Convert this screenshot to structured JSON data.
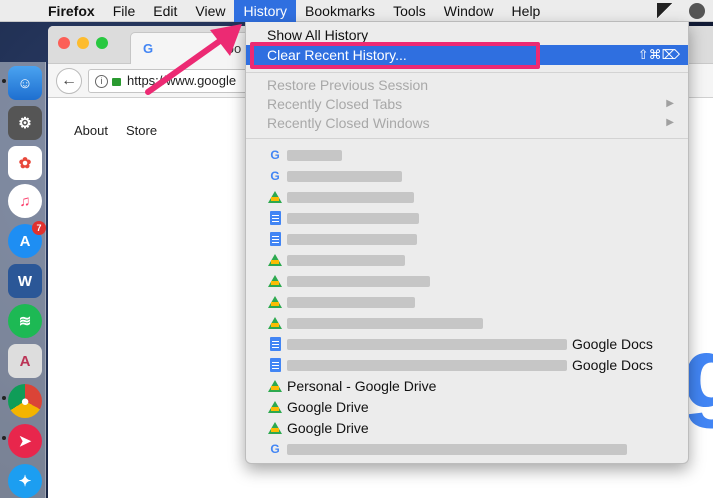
{
  "menubar": {
    "app_name": "Firefox",
    "items": [
      "File",
      "Edit",
      "View",
      "History",
      "Bookmarks",
      "Tools",
      "Window",
      "Help"
    ]
  },
  "dock": {
    "appstore_badge": "7"
  },
  "browser": {
    "url": "https://www.google",
    "tab_fragment": "oo",
    "page_links": [
      "About",
      "Store"
    ],
    "big_logo_letter": "g"
  },
  "history_menu": {
    "show_all": "Show All History",
    "clear_recent": "Clear Recent History...",
    "clear_shortcut": "⇧⌘⌦",
    "restore_session": "Restore Previous Session",
    "recently_closed_tabs": "Recently Closed Tabs",
    "recently_closed_windows": "Recently Closed Windows",
    "entries": [
      {
        "icon": "google-icon",
        "text": ""
      },
      {
        "icon": "google-icon",
        "text": ""
      },
      {
        "icon": "drive-icon",
        "text": ""
      },
      {
        "icon": "docs-icon",
        "text": ""
      },
      {
        "icon": "docs-icon",
        "text": ""
      },
      {
        "icon": "drive-icon",
        "text": ""
      },
      {
        "icon": "drive-icon",
        "text": ""
      },
      {
        "icon": "drive-icon",
        "text": ""
      },
      {
        "icon": "drive-icon",
        "text": ""
      },
      {
        "icon": "docs-icon",
        "text": "Google Docs"
      },
      {
        "icon": "docs-icon",
        "text": "Google Docs"
      },
      {
        "icon": "drive-icon",
        "text": "Personal - Google Drive"
      },
      {
        "icon": "drive-icon",
        "text": "Google Drive"
      },
      {
        "icon": "drive-icon",
        "text": "Google Drive"
      },
      {
        "icon": "google-icon",
        "text": ""
      }
    ]
  },
  "colors": {
    "menu_highlight": "#2f6fe0",
    "annotation": "#ec2a73",
    "drive_green": "#2da94f",
    "docs_blue": "#4285f4"
  }
}
